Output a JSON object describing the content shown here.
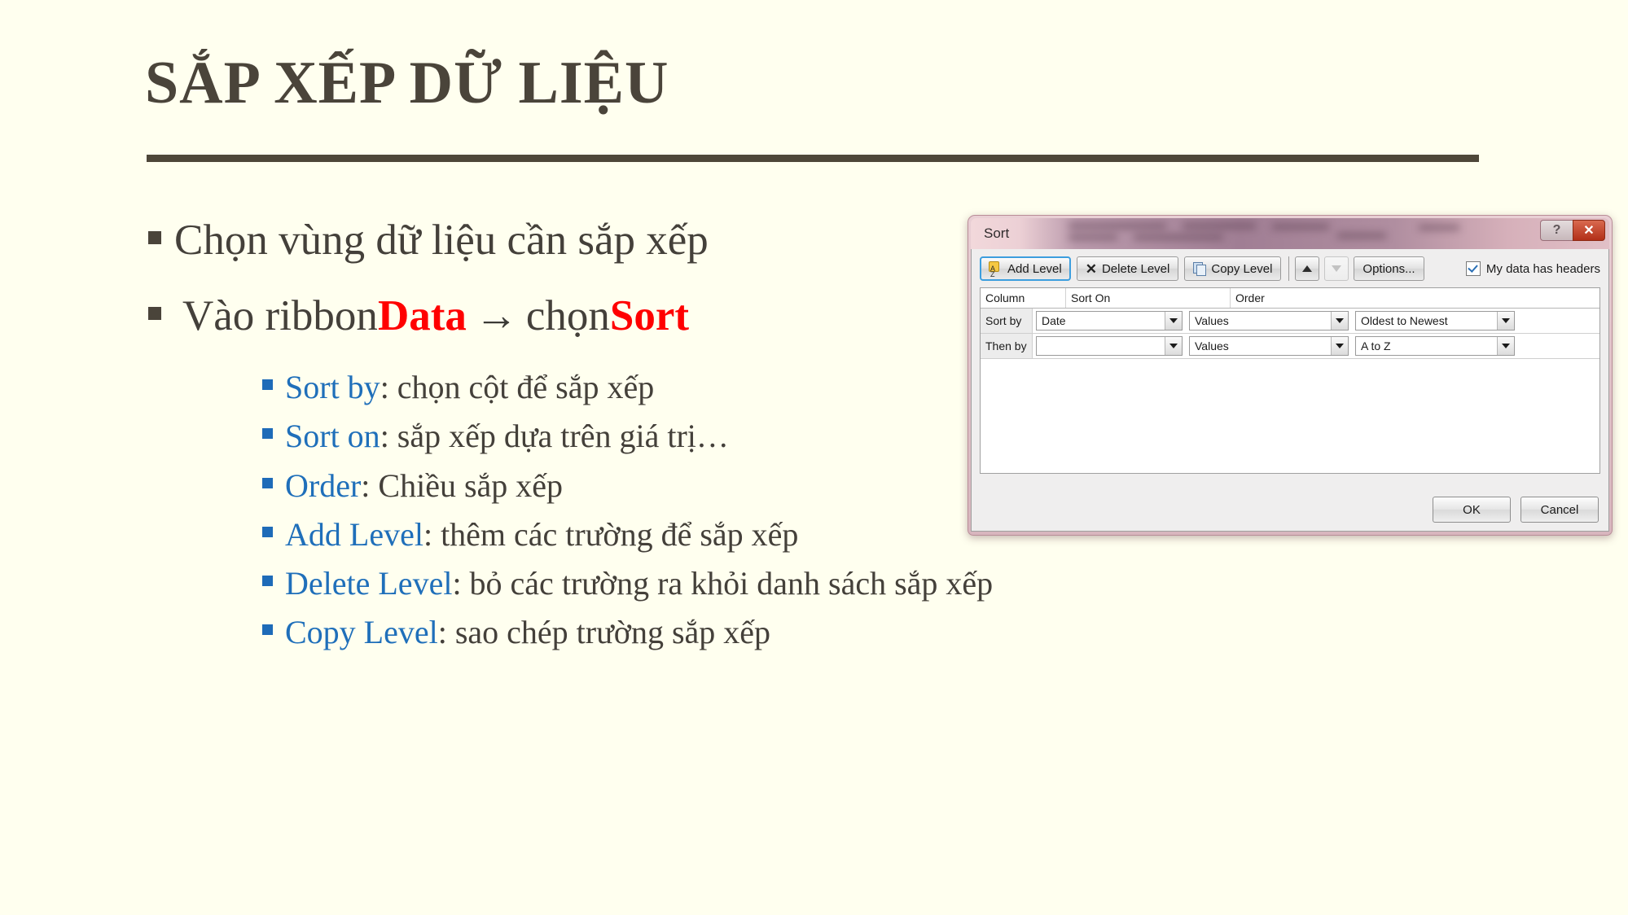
{
  "slide": {
    "title": "SẮP XẾP DỮ LIỆU",
    "colors": {
      "background": "#ffffef",
      "title": "#4a443a",
      "rule": "#4e4739",
      "body_text": "#44403a",
      "keyword_red": "#ff0000",
      "keyword_blue": "#1f6fba",
      "bullet_level1": "#4a443a",
      "bullet_level2": "#1e6bb8"
    },
    "bullets": [
      {
        "level": 1,
        "parts": [
          {
            "text": "Chọn vùng dữ liệu cần sắp xếp",
            "style": "plain"
          }
        ]
      },
      {
        "level": 1,
        "parts": [
          {
            "text": "Vào ribbon ",
            "style": "plain"
          },
          {
            "text": "Data",
            "style": "red-bold"
          },
          {
            "text": "→",
            "style": "arrow"
          },
          {
            "text": " chọn ",
            "style": "plain"
          },
          {
            "text": "Sort",
            "style": "red-bold"
          }
        ]
      }
    ],
    "subbullets": [
      {
        "term": "Sort by",
        "desc": ": chọn cột để sắp xếp"
      },
      {
        "term": "Sort on",
        "desc": ": sắp xếp dựa trên giá trị…"
      },
      {
        "term": "Order",
        "desc": ": Chiều sắp xếp"
      },
      {
        "term": "Add Level",
        "desc": ": thêm các trường để sắp xếp"
      },
      {
        "term": "Delete Level",
        "desc": ": bỏ các trường ra khỏi danh sách sắp xếp"
      },
      {
        "term": "Copy Level",
        "desc": ": sao chép trường sắp xếp"
      }
    ]
  },
  "dialog": {
    "title": "Sort",
    "window_buttons": {
      "help": "?",
      "close": "✕"
    },
    "toolbar": {
      "add_level": "Add Level",
      "add_level_mnemonic": "A",
      "delete_level": "Delete Level",
      "delete_level_mnemonic": "D",
      "copy_level": "Copy Level",
      "copy_level_mnemonic": "C",
      "move_up": "▲",
      "move_down": "▼",
      "options": "Options...",
      "options_mnemonic": "O",
      "headers_checkbox_label": "My data has headers",
      "headers_checkbox_checked": true
    },
    "grid": {
      "headers": [
        "Column",
        "Sort On",
        "Order"
      ],
      "rows": [
        {
          "label": "Sort by",
          "column": "Date",
          "sort_on": "Values",
          "order": "Oldest to Newest"
        },
        {
          "label": "Then by",
          "column": "",
          "sort_on": "Values",
          "order": "A to Z"
        }
      ]
    },
    "footer": {
      "ok": "OK",
      "cancel": "Cancel"
    }
  }
}
